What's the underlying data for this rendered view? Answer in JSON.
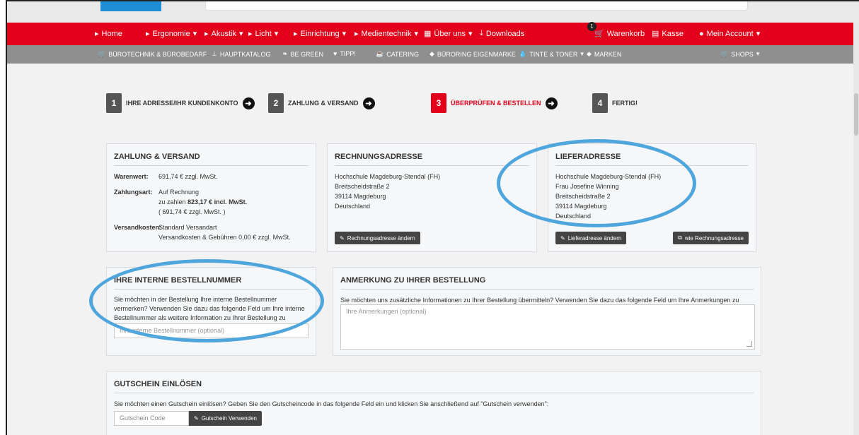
{
  "nav_main": {
    "home": "Home",
    "ergonomie": "Ergonomie",
    "akustik": "Akustik",
    "licht": "Licht",
    "einrichtung": "Einrichtung",
    "medientechnik": "Medientechnik",
    "ueber_uns": "Über uns",
    "downloads": "Downloads",
    "cart_count": "1",
    "warenkorb": "Warenkorb",
    "kasse": "Kasse",
    "account": "Mein Account"
  },
  "nav_sub": {
    "buerotechnik": "Bürotechnik & Bürobedarf",
    "hauptkatalog": "Hauptkatalog",
    "be_green": "Be Green",
    "tipp": "Tipp!",
    "catering": "Catering",
    "eigenmarke": "Büroring Eigenmarke",
    "tinte": "Tinte & Toner",
    "marken": "Marken",
    "shops": "Shops"
  },
  "steps": [
    {
      "num": "1",
      "label": "Ihre Adresse/Ihr Kundenkonto"
    },
    {
      "num": "2",
      "label": "Zahlung & Versand"
    },
    {
      "num": "3",
      "label": "Überprüfen & Bestellen"
    },
    {
      "num": "4",
      "label": "Fertig!"
    }
  ],
  "payment": {
    "title": "Zahlung & Versand",
    "warenwert_label": "Warenwert:",
    "warenwert_value": "691,74 € zzgl. MwSt.",
    "zahlungsart_label": "Zahlungsart:",
    "zahlungsart_1": "Auf Rechnung",
    "zahlungsart_2_pre": "zu zahlen ",
    "zahlungsart_2_bold": "823,17 € incl. MwSt.",
    "zahlungsart_3": "( 691,74 € zzgl. MwSt. )",
    "versand_label": "Versandkosten:",
    "versand_1": "Standard Versandart",
    "versand_2": "Versandkosten & Gebühren 0,00 € zzgl. MwSt."
  },
  "billing": {
    "title": "Rechnungsadresse",
    "line1": "Hochschule Magdeburg-Stendal (FH)",
    "line2": "Breitscheidstraße 2",
    "line3": "39114 Magdeburg",
    "line4": "Deutschland",
    "change_btn": "Rechnungsadresse ändern"
  },
  "shipping": {
    "title": "Lieferadresse",
    "line1": "Hochschule Magdeburg-Stendal (FH)",
    "line2": "Frau Josefine Winning",
    "line3": "Breitscheidstraße 2",
    "line4": "39114 Magdeburg",
    "line5": "Deutschland",
    "change_btn": "Lieferadresse ändern",
    "same_btn": "wie Rechnungsadresse"
  },
  "order_number": {
    "title": "Ihre interne Bestellnummer",
    "text": "Sie möchten in der Bestellung Ihre interne Bestellnummer vermerken? Verwenden Sie dazu das folgende Feld um Ihre interne Bestellnummer als weitere Information zu Ihrer Bestellung zu speichern:",
    "placeholder": "Ihre interne Bestellnummer (optional)"
  },
  "remarks": {
    "title": "Anmerkung zu Ihrer Bestellung",
    "text": "Sie möchten uns zusätzliche Informationen zu Ihrer Bestellung übermitteln? Verwenden Sie dazu das folgende Feld um Ihre Anmerkungen zu übermitteln:",
    "placeholder": "Ihre Anmerkungen (optional)"
  },
  "voucher": {
    "title": "Gutschein einlösen",
    "text": "Sie möchten einen Gutschein einlösen? Geben Sie den Gutscheincode in das folgende Feld ein und klicken Sie anschließend auf \"Gutschein verwenden\":",
    "placeholder": "Gutschein Code",
    "button": "Gutschein Verwenden"
  },
  "colors": {
    "brand_red": "#e2001a",
    "sub_nav_grey": "#8f8f8f",
    "highlight_circle": "#4fa6dd"
  }
}
